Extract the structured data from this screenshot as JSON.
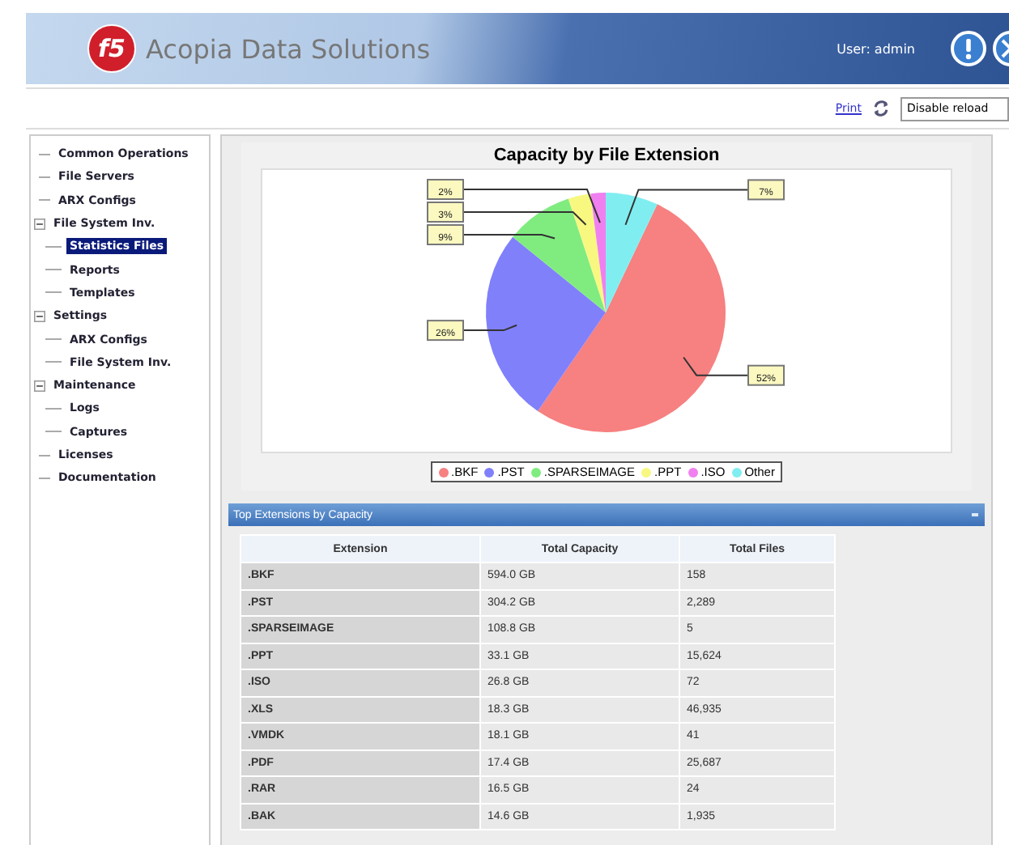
{
  "header": {
    "logo": "f5",
    "title": "Acopia Data Solutions",
    "user": "User: admin"
  },
  "toolbar": {
    "print_link": "Print",
    "reload_select": "Disable reload"
  },
  "sidebar": {
    "items": [
      {
        "label": "Common Operations",
        "selected": false
      },
      {
        "label": "File Servers",
        "selected": false
      },
      {
        "label": "ARX Configs",
        "selected": false
      },
      {
        "label": "File System Inv.",
        "selected": false,
        "expanded": true,
        "children": [
          {
            "label": "Statistics Files",
            "selected": true
          },
          {
            "label": "Reports",
            "selected": false
          },
          {
            "label": "Templates",
            "selected": false
          }
        ]
      },
      {
        "label": "Settings",
        "selected": false,
        "expanded": true,
        "children": [
          {
            "label": "ARX Configs",
            "selected": false
          },
          {
            "label": "File System Inv.",
            "selected": false
          }
        ]
      },
      {
        "label": "Maintenance",
        "selected": false,
        "expanded": true,
        "children": [
          {
            "label": "Logs",
            "selected": false
          },
          {
            "label": "Captures",
            "selected": false
          }
        ]
      },
      {
        "label": "Licenses",
        "selected": false
      },
      {
        "label": "Documentation",
        "selected": false
      }
    ]
  },
  "chart": {
    "chart_data": {
      "type": "pie",
      "title": "Capacity by File Extension",
      "categories": [
        ".BKF",
        ".PST",
        ".SPARSEIMAGE",
        ".PPT",
        ".ISO",
        "Other"
      ],
      "values": [
        52,
        26,
        9,
        3,
        2,
        7
      ],
      "colors": [
        "#f78080",
        "#8080fb",
        "#80ec80",
        "#f8f880",
        "#f080f0",
        "#80eef0"
      ],
      "value_labels": [
        "52%",
        "26%",
        "9%",
        "3%",
        "2%",
        "7%"
      ]
    }
  },
  "table_panel": {
    "title": "Top Extensions by Capacity",
    "columns": [
      "Extension",
      "Total Capacity",
      "Total Files"
    ],
    "rows": [
      [
        ".BKF",
        "594.0 GB",
        "158"
      ],
      [
        ".PST",
        "304.2 GB",
        "2,289"
      ],
      [
        ".SPARSEIMAGE",
        "108.8 GB",
        "5"
      ],
      [
        ".PPT",
        "33.1 GB",
        "15,624"
      ],
      [
        ".ISO",
        "26.8 GB",
        "72"
      ],
      [
        ".XLS",
        "18.3 GB",
        "46,935"
      ],
      [
        ".VMDK",
        "18.1 GB",
        "41"
      ],
      [
        ".PDF",
        "17.4 GB",
        "25,687"
      ],
      [
        ".RAR",
        "16.5 GB",
        "24"
      ],
      [
        ".BAK",
        "14.6 GB",
        "1,935"
      ]
    ]
  }
}
